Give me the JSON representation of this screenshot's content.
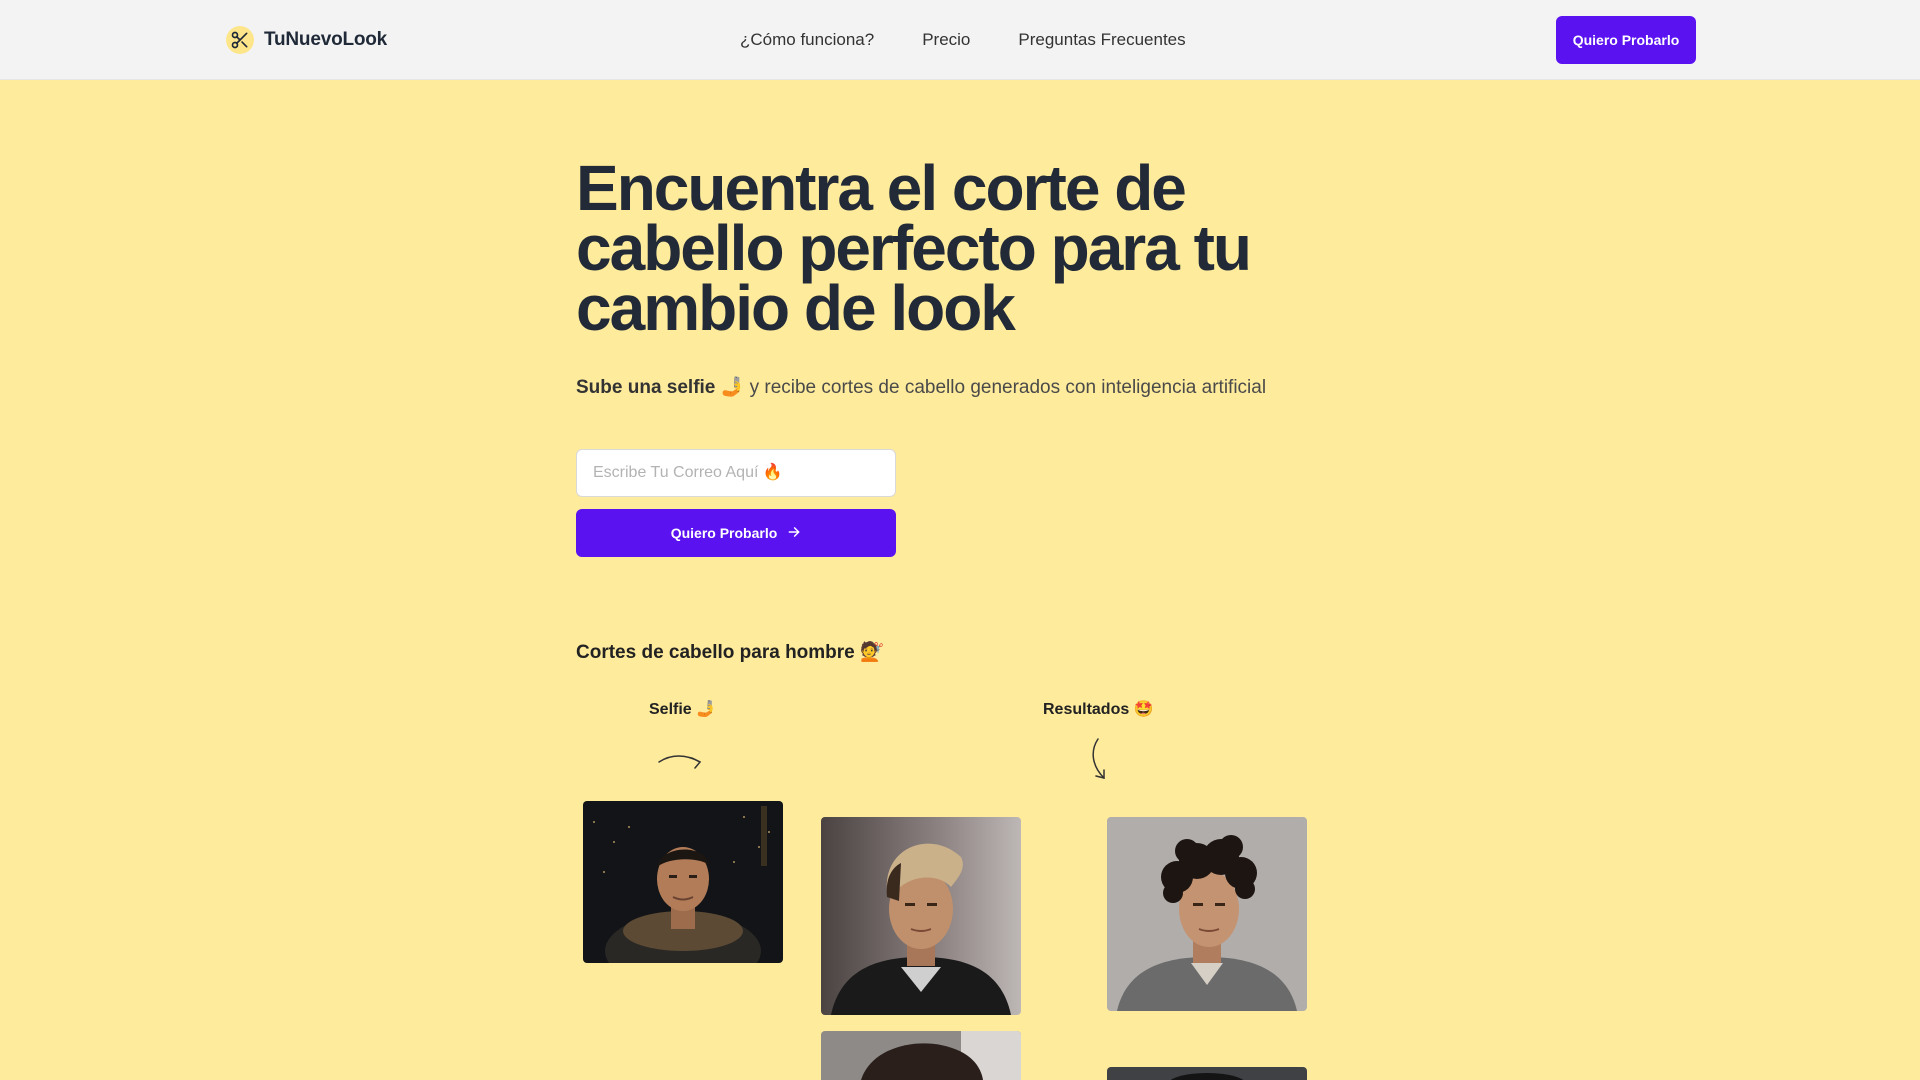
{
  "nav": {
    "brand": "TuNuevoLook",
    "brand_icon": "scissors-icon",
    "links": [
      "¿Cómo funciona?",
      "Precio",
      "Preguntas Frecuentes"
    ],
    "cta": "Quiero Probarlo"
  },
  "hero": {
    "title": "Encuentra el corte de cabello perfecto para tu cambio de look",
    "subtitle_bold": "Sube una selfie 🤳",
    "subtitle_rest": " y recibe cortes de cabello generados con inteligencia artificial",
    "email_placeholder": "Escribe Tu Correo Aquí 🔥",
    "cta": "Quiero Probarlo",
    "cta_icon": "arrow-right-icon"
  },
  "examples": {
    "section_title": "Cortes de cabello para hombre 💇",
    "selfie_label": "Selfie 🤳",
    "results_label": "Resultados 🤩"
  },
  "colors": {
    "background": "#feeb9c",
    "accent": "#5b12f0",
    "nav_bg": "#f3f3f3"
  }
}
